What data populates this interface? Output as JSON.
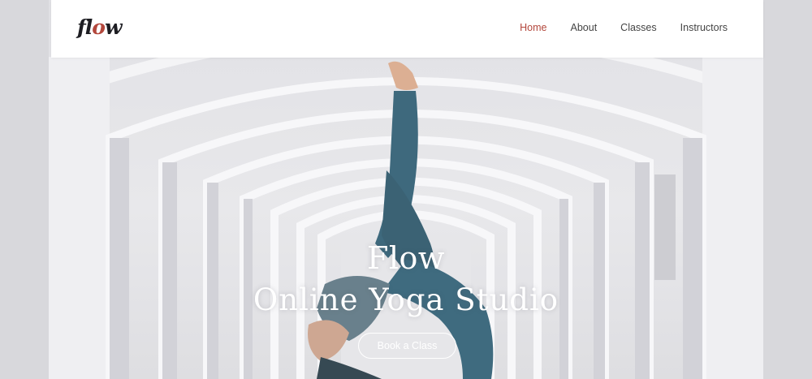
{
  "brand": {
    "logo_start": "fl",
    "logo_mid": "o",
    "logo_end": "w",
    "accent_color": "#b3473c"
  },
  "nav": {
    "items": [
      {
        "label": "Home",
        "active": true
      },
      {
        "label": "About",
        "active": false
      },
      {
        "label": "Classes",
        "active": false
      },
      {
        "label": "Instructors",
        "active": false
      }
    ]
  },
  "hero": {
    "title_line1": "Flow",
    "title_line2": "Online Yoga Studio",
    "cta_label": "Book a Class",
    "background": "arched-corridor-photo-with-yoga-pose"
  }
}
